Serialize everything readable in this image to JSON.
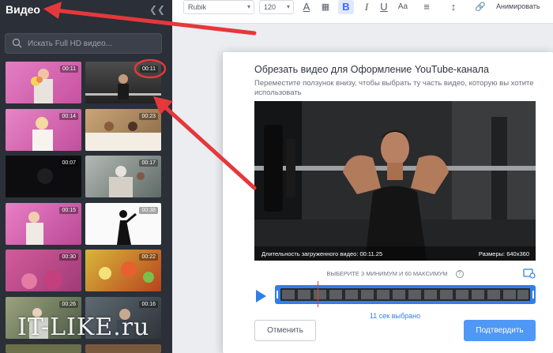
{
  "sidebar": {
    "title": "Видео",
    "search_placeholder": "Искать Full HD видео...",
    "thumbnails": [
      {
        "duration": "00:11"
      },
      {
        "duration": "00:11"
      },
      {
        "duration": "00:14"
      },
      {
        "duration": "00:23"
      },
      {
        "duration": "00:07"
      },
      {
        "duration": "00:17"
      },
      {
        "duration": "00:15"
      },
      {
        "duration": "00:38"
      },
      {
        "duration": "00:30"
      },
      {
        "duration": "00:22"
      },
      {
        "duration": "00:26"
      },
      {
        "duration": "00:16"
      },
      {
        "duration": ""
      },
      {
        "duration": ""
      }
    ]
  },
  "toolbar": {
    "font_name": "Rubik",
    "font_size": "120",
    "animate_label": "Анимировать"
  },
  "dialog": {
    "title": "Обрезать видео для Оформление YouTube-канала",
    "subtitle": "Переместите ползунок внизу, чтобы выбрать ту часть видео, которую вы хотите использовать",
    "video_duration_label": "Длительность загруженного видео: 00:11.25",
    "video_size_label": "Размеры: 640x360",
    "hint": "ВЫБЕРИТЕ 3 МИНИМУМ И 60 МАКСИМУМ",
    "help_glyph": "?",
    "selected_text": "11 сек выбрано",
    "cancel_label": "Отменить",
    "confirm_label": "Подтвердить"
  },
  "watermark": "IT-LIKE.ru",
  "colors": {
    "sidebar_bg": "#2b2f37",
    "accent": "#4f98f5",
    "timeline": "#2f7fea",
    "annotation_red": "#e5383b"
  },
  "icons": [
    "collapse-icon",
    "search-icon",
    "text-color-icon",
    "checker-icon",
    "bold-icon",
    "italic-icon",
    "underline-icon",
    "font-case-icon",
    "align-icon",
    "spacing-icon",
    "link-icon",
    "play-icon",
    "trim-icon",
    "help-icon"
  ]
}
